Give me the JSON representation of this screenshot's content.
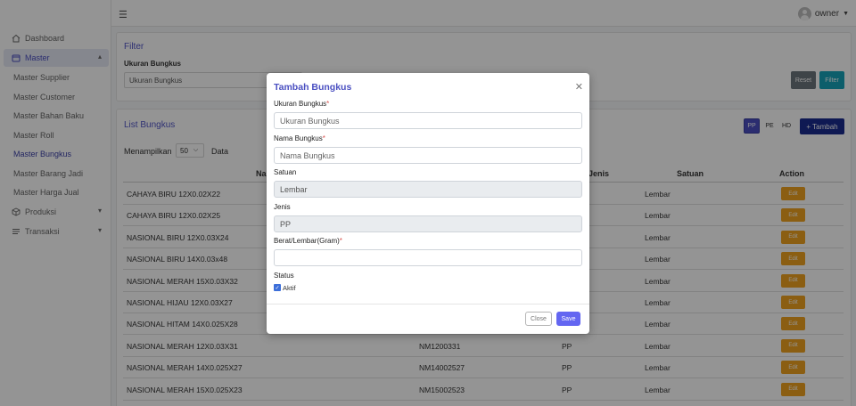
{
  "sidebar": {
    "items": [
      {
        "label": "Dashboard",
        "icon": "home-icon"
      },
      {
        "label": "Master",
        "icon": "calendar-icon"
      },
      {
        "label": "Produksi",
        "icon": "box-icon"
      },
      {
        "label": "Transaksi",
        "icon": "list-icon"
      }
    ],
    "sub_items": [
      "Master Supplier",
      "Master Customer",
      "Master Bahan Baku",
      "Master Roll",
      "Master Bungkus",
      "Master Barang Jadi",
      "Master Harga Jual"
    ]
  },
  "topbar": {
    "username": "owner"
  },
  "filter": {
    "title": "Filter",
    "field_label": "Ukuran Bungkus",
    "field_value": "Ukuran Bungkus",
    "reset_label": "Reset",
    "filter_label": "Filter"
  },
  "list": {
    "title": "List Bungkus",
    "tabs": [
      "PP",
      "PE",
      "HD"
    ],
    "add_label": "+ Tambah",
    "show_label": "Menampilkan",
    "page_size": "50",
    "data_label": "Data",
    "headers": {
      "name": "Na",
      "jenis": "Jenis",
      "satuan": "Satuan",
      "action": "Action"
    },
    "edit_label": "Edit",
    "rows": [
      {
        "name": "CAHAYA BIRU 12X0.02X22",
        "code": "",
        "jenis": "",
        "satuan": "Lembar"
      },
      {
        "name": "CAHAYA BIRU 12X0.02X25",
        "code": "",
        "jenis": "",
        "satuan": "Lembar"
      },
      {
        "name": "NASIONAL BIRU 12X0.03X24",
        "code": "",
        "jenis": "",
        "satuan": "Lembar"
      },
      {
        "name": "NASIONAL BIRU 14X0.03x48",
        "code": "",
        "jenis": "",
        "satuan": "Lembar"
      },
      {
        "name": "NASIONAL MERAH 15X0.03X32",
        "code": "",
        "jenis": "",
        "satuan": "Lembar"
      },
      {
        "name": "NASIONAL HIJAU 12X0.03X27",
        "code": "",
        "jenis": "",
        "satuan": "Lembar"
      },
      {
        "name": "NASIONAL HITAM 14X0.025X28",
        "code": "",
        "jenis": "",
        "satuan": "Lembar"
      },
      {
        "name": "NASIONAL MERAH 12X0.03X31",
        "code": "NM1200331",
        "jenis": "PP",
        "satuan": "Lembar"
      },
      {
        "name": "NASIONAL MERAH 14X0.025X27",
        "code": "NM14002527",
        "jenis": "PP",
        "satuan": "Lembar"
      },
      {
        "name": "NASIONAL MERAH 15X0.025X23",
        "code": "NM15002523",
        "jenis": "PP",
        "satuan": "Lembar"
      }
    ]
  },
  "modal": {
    "title": "Tambah Bungkus",
    "fields": {
      "ukuran": {
        "label": "Ukuran Bungkus",
        "placeholder": "Ukuran Bungkus"
      },
      "nama": {
        "label": "Nama Bungkus",
        "placeholder": "Nama Bungkus"
      },
      "satuan": {
        "label": "Satuan",
        "value": "Lembar"
      },
      "jenis": {
        "label": "Jenis",
        "value": "PP"
      },
      "berat": {
        "label": "Berat/Lembar(Gram)",
        "value": ""
      },
      "status": {
        "label": "Status",
        "checkbox_label": "Aktif"
      }
    },
    "required_mark": "*",
    "close_label": "Close",
    "save_label": "Save"
  },
  "colors": {
    "accent": "#5155c7",
    "primary_dark": "#1a2b8f",
    "edit": "#f0a31f",
    "save": "#6366f1",
    "filter_btn": "#17a2b8"
  }
}
